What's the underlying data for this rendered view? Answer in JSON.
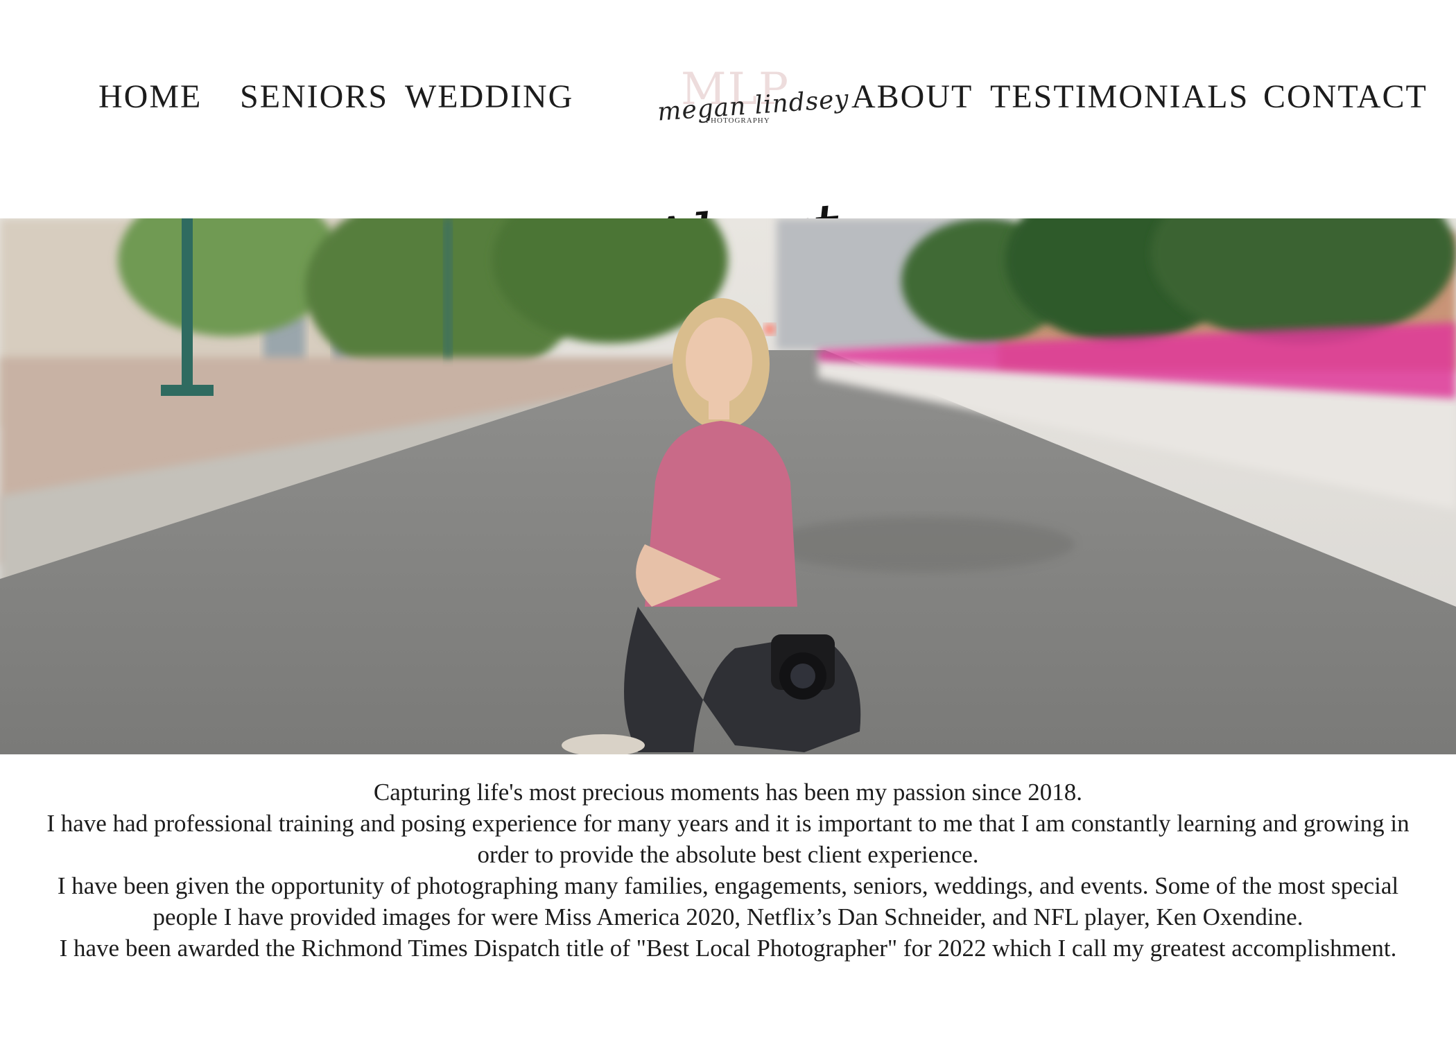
{
  "nav": {
    "items": [
      {
        "label": "HOME"
      },
      {
        "label": "SENIORS"
      },
      {
        "label": "WEDDING"
      },
      {
        "label": "ABOUT"
      },
      {
        "label": "TESTIMONIALS"
      },
      {
        "label": "CONTACT"
      }
    ]
  },
  "logo": {
    "monogram": "MLP",
    "name": "megan lindsey",
    "sub": "PHOTOGRAPHY"
  },
  "page": {
    "heading": "About"
  },
  "bio": {
    "paragraphs": [
      "Capturing life's most precious moments has been my passion since 2018.",
      "I have had professional training and posing experience for many years and it is important to me that I am constantly learning and growing in order to provide the absolute best client experience.",
      "I have been given the opportunity of photographing many families, engagements, seniors, weddings, and events. Some of the most special people I have provided images for were Miss America 2020, Netflix’s Dan Schneider, and NFL player, Ken Oxendine.",
      "I have been awarded the Richmond Times Dispatch title of \"Best Local Photographer\" for 2022 which I call my greatest accomplishment."
    ]
  },
  "colors": {
    "text": "#1c1c1c",
    "logo_monogram": "#eddcdc",
    "flowers": "#e0379a",
    "top": "#c96a88"
  }
}
